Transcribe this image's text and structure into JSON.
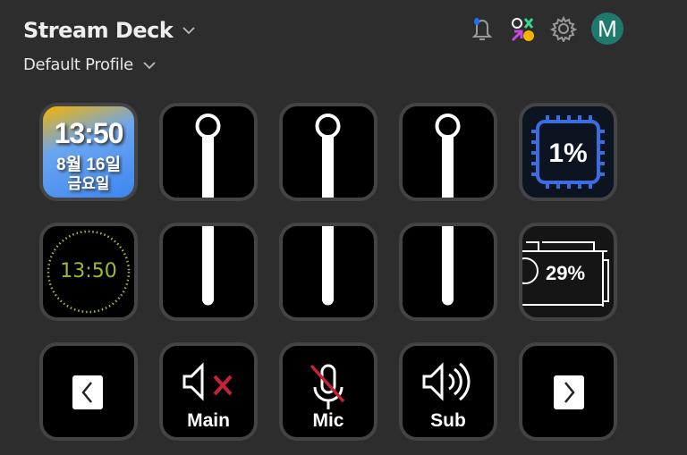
{
  "header": {
    "title": "Stream Deck",
    "profile": "Default Profile",
    "avatar_letter": "M",
    "icons": [
      "bell-icon",
      "marketplace-icon",
      "gear-icon"
    ],
    "notification_color": "#1a73ff",
    "avatar_color": "#1f7a6d"
  },
  "keys": {
    "date_clock": {
      "time": "13:50",
      "date": "8월 16일",
      "weekday": "금요일"
    },
    "analog_clock": {
      "time": "13:50",
      "color": "#a3b82a"
    },
    "cpu": {
      "value": "1%",
      "color": "#3b6de0"
    },
    "gpu": {
      "value": "29%"
    },
    "sliders": [
      {
        "level": 1.0
      },
      {
        "level": 1.0
      },
      {
        "level": 1.0
      }
    ],
    "prev_page": {
      "icon": "chevron-left-icon"
    },
    "main": {
      "label": "Main",
      "muted": true
    },
    "mic": {
      "label": "Mic",
      "muted": true
    },
    "sub": {
      "label": "Sub",
      "muted": false
    },
    "next_page": {
      "icon": "chevron-right-icon"
    }
  }
}
